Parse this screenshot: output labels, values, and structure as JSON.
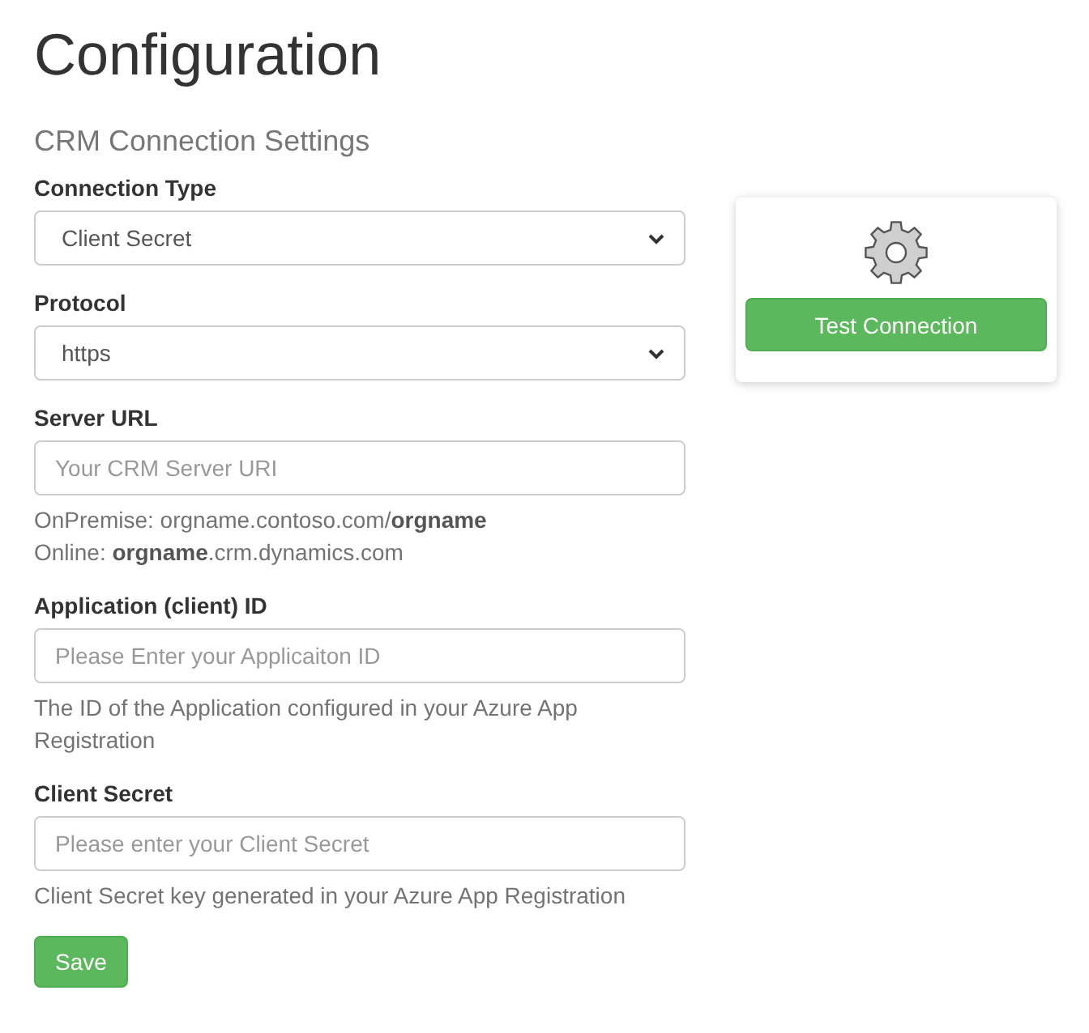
{
  "title": "Configuration",
  "subtitle": "CRM Connection Settings",
  "fields": [
    {
      "kind": "select",
      "label": "Connection Type",
      "value": "Client Secret"
    },
    {
      "kind": "select",
      "label": "Protocol",
      "value": "https"
    },
    {
      "kind": "input",
      "label": "Server URL",
      "placeholder": "Your CRM Server URI",
      "help": [
        "OnPremise: orgname.contoso.com/**orgname**",
        "Online: **orgname**.crm.dynamics.com"
      ]
    },
    {
      "kind": "input",
      "label": "Application (client) ID",
      "placeholder": "Please Enter your Applicaiton ID",
      "help": [
        "The ID of the Application configured in your Azure App Registration"
      ]
    },
    {
      "kind": "input",
      "label": "Client Secret",
      "placeholder": "Please enter your Client Secret",
      "help": [
        "Client Secret key generated in your Azure App Registration"
      ]
    }
  ],
  "save_button": "Save",
  "test_card": {
    "button": "Test Connection"
  }
}
